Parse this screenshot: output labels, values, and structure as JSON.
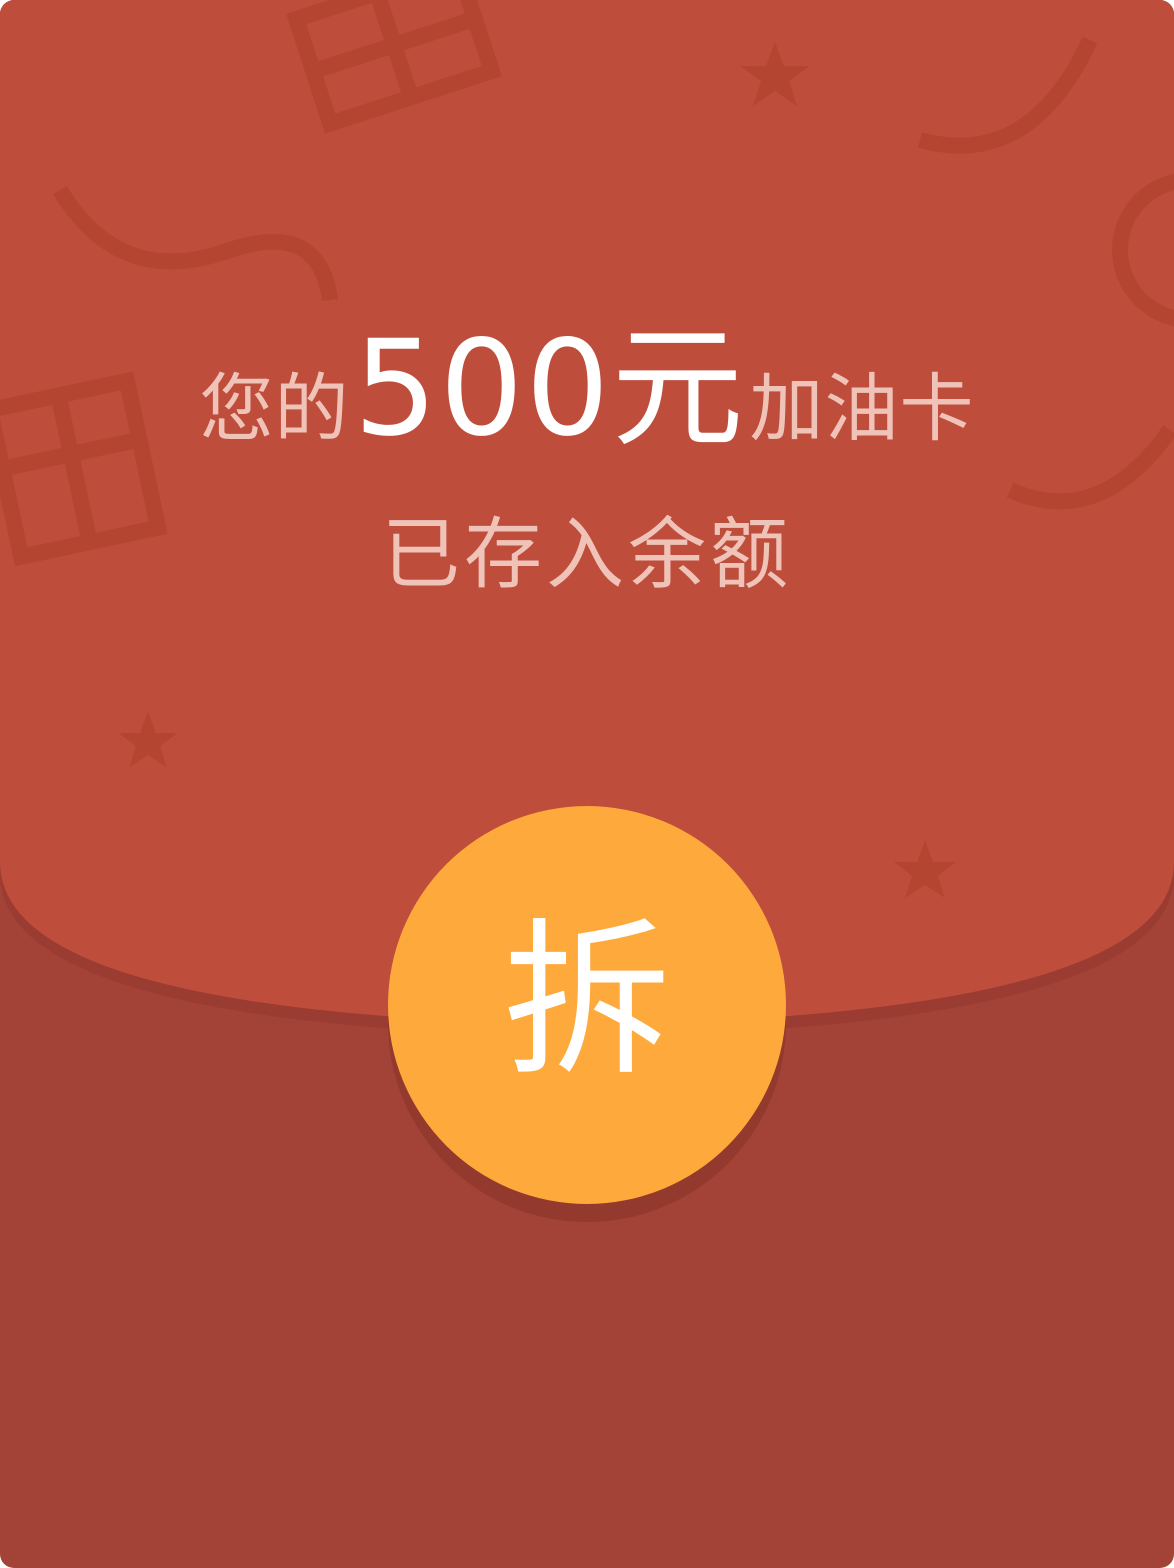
{
  "envelope": {
    "prefix": "您的",
    "amount": "500元",
    "suffix": "加油卡",
    "subtitle": "已存入余额",
    "open_label": "拆"
  },
  "colors": {
    "flap": "#bf4d3b",
    "body": "#a34236",
    "button": "#fea93b",
    "muted_text": "#f0c3b8",
    "highlight_text": "#ffffff"
  }
}
